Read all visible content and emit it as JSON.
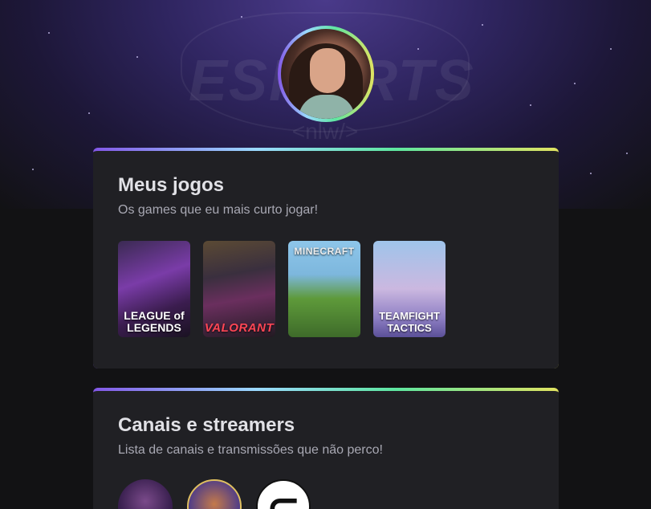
{
  "profile": {
    "avatar_alt": "Profile photo"
  },
  "games_section": {
    "title": "Meus jogos",
    "subtitle": "Os games que eu mais curto jogar!",
    "games": [
      {
        "title": "LEAGUE of LEGENDS",
        "name": "league-of-legends"
      },
      {
        "title": "VALORANT",
        "name": "valorant"
      },
      {
        "title": "MINECRAFT",
        "name": "minecraft"
      },
      {
        "title": "TEAMFIGHT TACTICS",
        "name": "teamfight-tactics"
      }
    ]
  },
  "channels_section": {
    "title": "Canais e streamers",
    "subtitle": "Lista de canais e transmissões que não perco!"
  },
  "colors": {
    "background": "#121214",
    "card": "#202024",
    "title": "#e1e1e6",
    "subtitle": "#a8a8b3",
    "accent_gradient": [
      "#8257e6",
      "#9bd9ff",
      "#5ee6a0",
      "#e1e361"
    ]
  }
}
